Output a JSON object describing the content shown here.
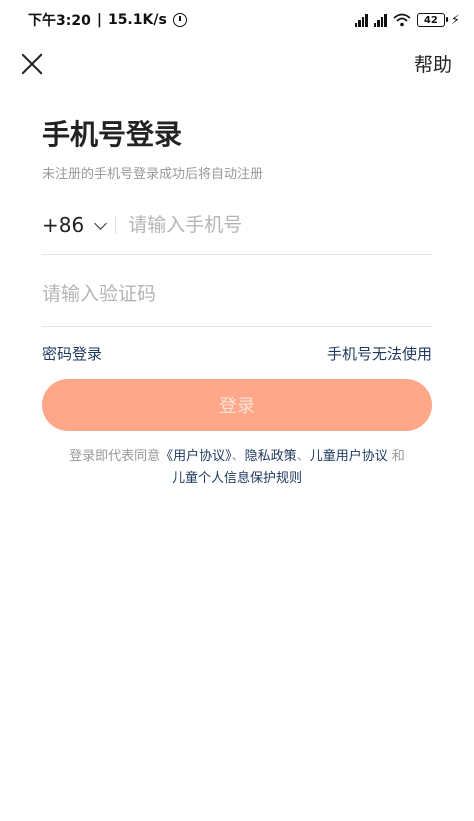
{
  "status_bar": {
    "time": "下午3:20",
    "separator": "|",
    "net_speed": "15.1K/s",
    "battery": "42"
  },
  "header": {
    "help_label": "帮助"
  },
  "title": "手机号登录",
  "subtitle": "未注册的手机号登录成功后将自动注册",
  "phone": {
    "country_code": "+86",
    "placeholder": "请输入手机号"
  },
  "code": {
    "placeholder": "请输入验证码"
  },
  "links": {
    "password_login": "密码登录",
    "phone_unavailable": "手机号无法使用"
  },
  "login_button": "登录",
  "agreement": {
    "prefix": "登录即代表同意",
    "user_agreement": "《用户协议》",
    "sep1": "、",
    "privacy": "隐私政策",
    "sep2": "、",
    "child_user_agreement": "儿童用户协议",
    "and": "和",
    "child_privacy": "儿童个人信息保护规则"
  },
  "icons": {
    "close": "close-icon",
    "chevron": "chevron-down-icon"
  }
}
